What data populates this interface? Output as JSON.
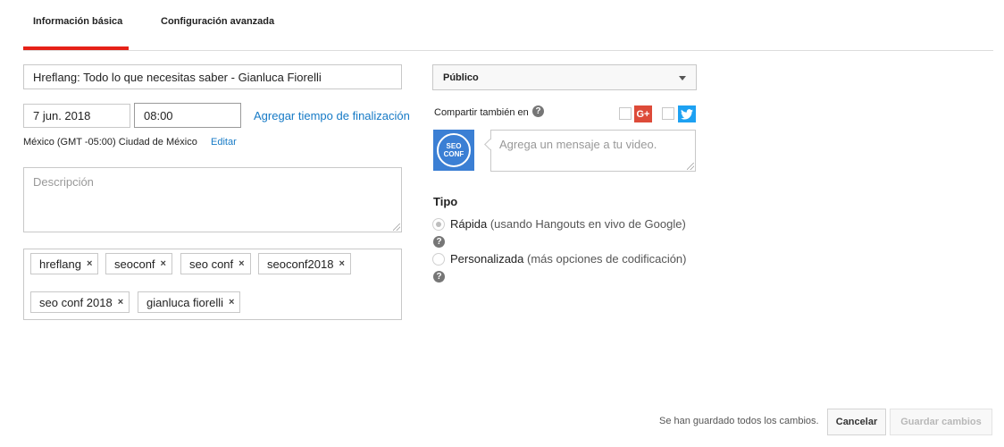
{
  "tabs": [
    {
      "label": "Información básica",
      "active": true
    },
    {
      "label": "Configuración avanzada",
      "active": false
    }
  ],
  "title_input": {
    "value": "Hreflang: Todo lo que necesitas saber - Gianluca Fiorelli"
  },
  "schedule": {
    "date": "7 jun. 2018",
    "time": "08:00",
    "add_end_time_link": "Agregar tiempo de finalización",
    "timezone": "México (GMT -05:00) Ciudad de México",
    "edit_link": "Editar"
  },
  "description": {
    "placeholder": "Descripción"
  },
  "tags": [
    "hreflang",
    "seoconf",
    "seo conf",
    "seoconf2018",
    "seo conf 2018",
    "gianluca fiorelli"
  ],
  "tag_remove_symbol": "×",
  "privacy": {
    "selected": "Público"
  },
  "share": {
    "label": "Compartir también en",
    "help_symbol": "?",
    "google_plus_glyph": "G+",
    "message_placeholder": "Agrega un mensaje a tu video.",
    "channel_avatar_text": [
      "SEO",
      "CONF"
    ]
  },
  "type_section": {
    "heading": "Tipo",
    "options": [
      {
        "label": "Rápida",
        "detail": "(usando Hangouts en vivo de Google)",
        "checked": true
      },
      {
        "label": "Personalizada",
        "detail": "(más opciones de codificación)",
        "checked": false
      }
    ]
  },
  "footer": {
    "status": "Se han guardado todos los cambios.",
    "cancel_label": "Cancelar",
    "save_label": "Guardar cambios"
  },
  "colors": {
    "tab_accent": "#e62117",
    "link": "#167ac6",
    "google_plus": "#dd4b39",
    "twitter": "#1da1f2",
    "avatar_bg": "#3b7fd4"
  }
}
